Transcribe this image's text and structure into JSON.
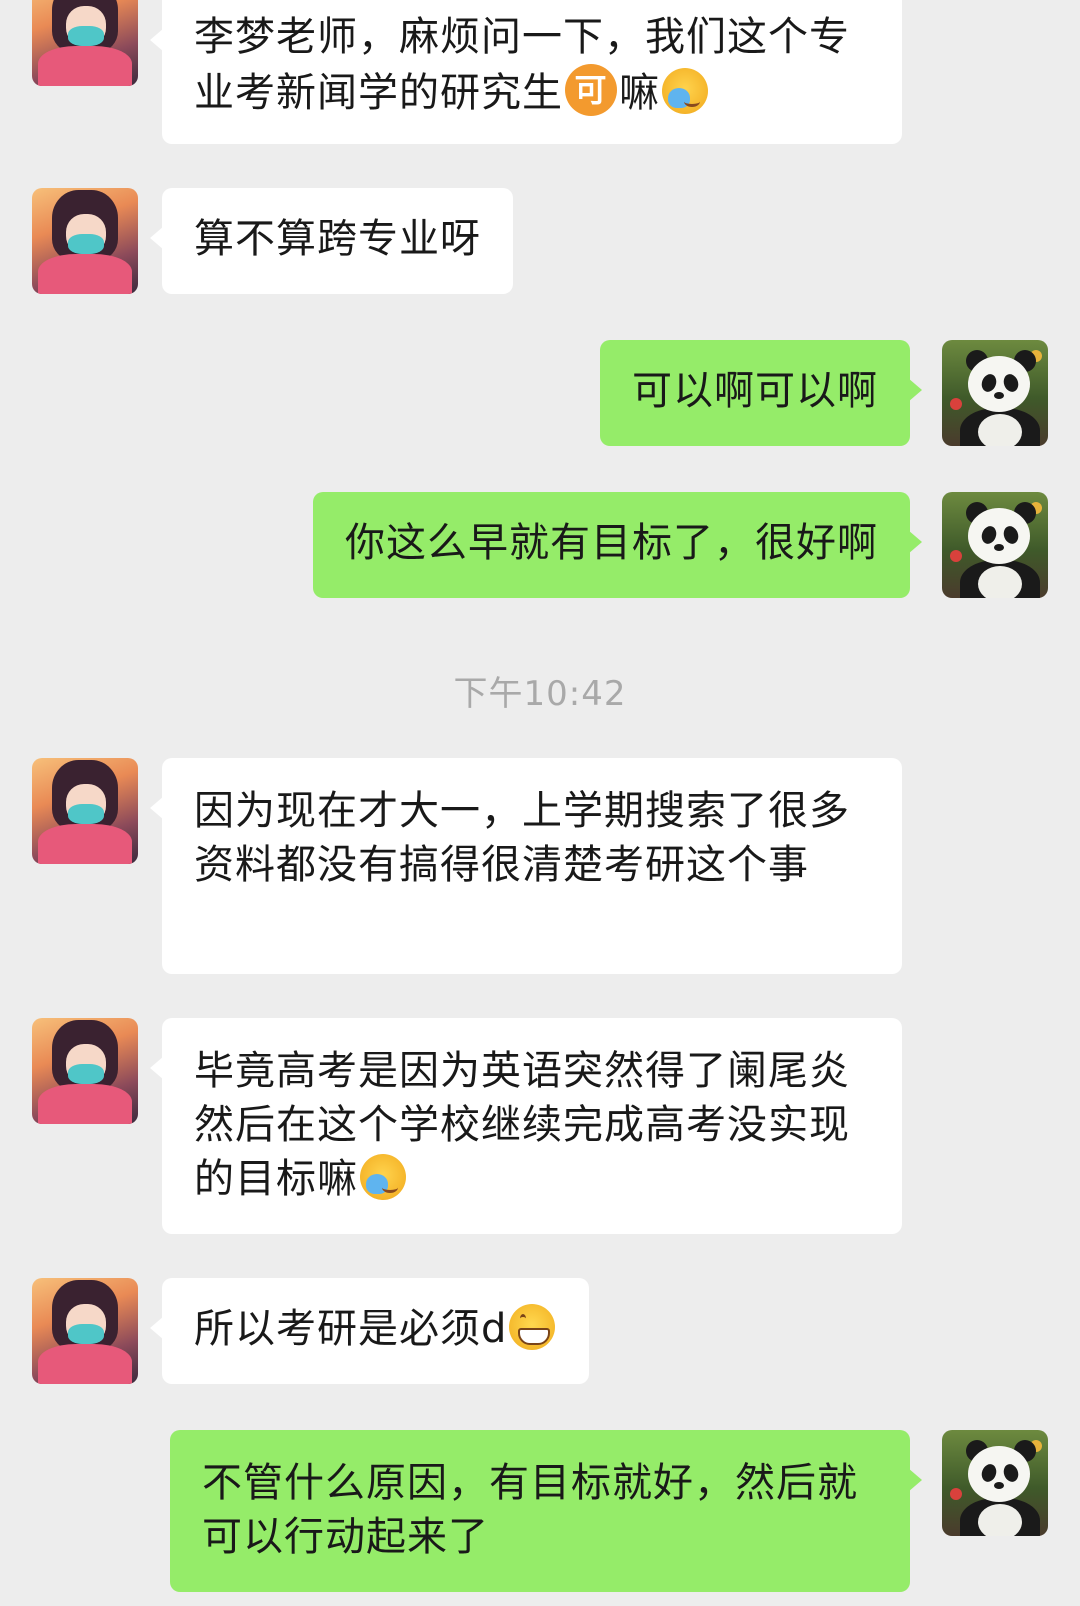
{
  "chat": {
    "timestamp": "下午10:42",
    "messages": [
      {
        "sender": "other",
        "avatar": "anime-girl-avatar",
        "segments": [
          {
            "type": "text",
            "value": "李梦老师，麻烦问一下，我们这个专业考新闻学的研究生"
          },
          {
            "type": "emoji",
            "name": "ke-emoji",
            "glyph": "可"
          },
          {
            "type": "text",
            "value": "嘛"
          },
          {
            "type": "emoji",
            "name": "cry-emoji"
          }
        ]
      },
      {
        "sender": "other",
        "avatar": "anime-girl-avatar",
        "segments": [
          {
            "type": "text",
            "value": "算不算跨专业呀"
          }
        ]
      },
      {
        "sender": "me",
        "avatar": "panda-avatar",
        "segments": [
          {
            "type": "text",
            "value": "可以啊可以啊"
          }
        ]
      },
      {
        "sender": "me",
        "avatar": "panda-avatar",
        "segments": [
          {
            "type": "text",
            "value": "你这么早就有目标了，很好啊"
          }
        ]
      },
      {
        "sender": "other",
        "avatar": "anime-girl-avatar",
        "segments": [
          {
            "type": "text",
            "value": "因为现在才大一，上学期搜索了很多资料都没有搞得很清楚考研这个事"
          }
        ]
      },
      {
        "sender": "other",
        "avatar": "anime-girl-avatar",
        "segments": [
          {
            "type": "text",
            "value": "毕竟高考是因为英语突然得了阑尾炎然后在这个学校继续完成高考没实现的目标嘛"
          },
          {
            "type": "emoji",
            "name": "cry-emoji"
          }
        ]
      },
      {
        "sender": "other",
        "avatar": "anime-girl-avatar",
        "segments": [
          {
            "type": "text",
            "value": "所以考研是必须d"
          },
          {
            "type": "emoji",
            "name": "grin-emoji"
          }
        ]
      },
      {
        "sender": "me",
        "avatar": "panda-avatar",
        "segments": [
          {
            "type": "text",
            "value": "不管什么原因，有目标就好，然后就可以行动起来了"
          }
        ]
      }
    ]
  }
}
